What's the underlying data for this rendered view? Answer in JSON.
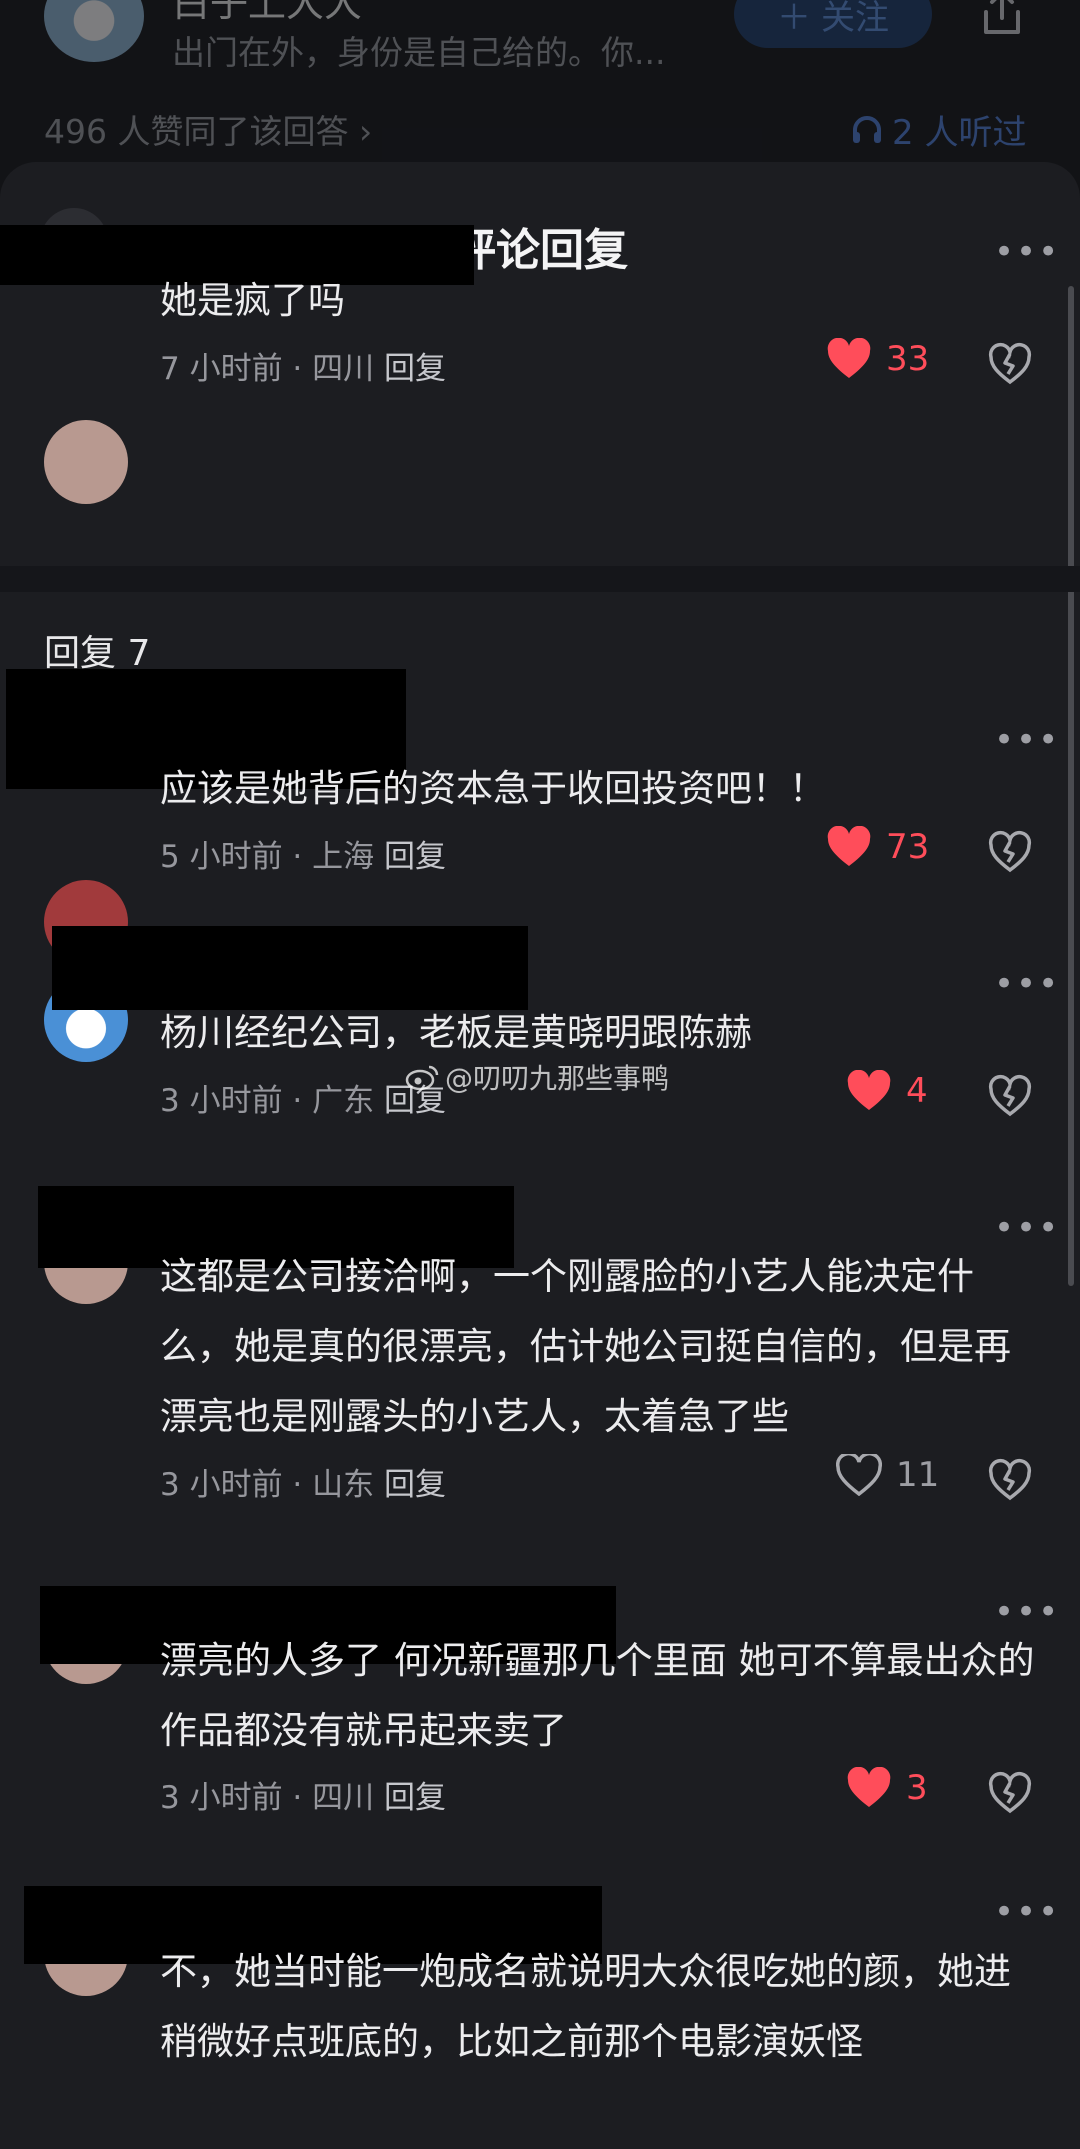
{
  "background": {
    "author_name": "白子上大大",
    "author_desc": "出门在外，身份是自己给的。你...",
    "follow_label": "关注",
    "upvote_text": "496 人赞同了该回答",
    "listen_text": "2 人听过"
  },
  "sheet": {
    "title": "评论回复",
    "reply_count_label": "回复 7"
  },
  "parent_comment": {
    "text": "她是疯了吗",
    "time": "7 小时前",
    "location": "四川",
    "reply_label": "回复",
    "likes": "33",
    "liked": true
  },
  "replies": [
    {
      "text": "应该是她背后的资本急于收回投资吧！！",
      "time": "5 小时前",
      "location": "上海",
      "reply_label": "回复",
      "likes": "73",
      "liked": true
    },
    {
      "text": "杨川经纪公司，老板是黄晓明跟陈赫",
      "time": "3 小时前",
      "location": "广东",
      "reply_label": "回复",
      "likes": "4",
      "liked": true
    },
    {
      "text": "这都是公司接洽啊，一个刚露脸的小艺人能决定什么，她是真的很漂亮，估计她公司挺自信的，但是再漂亮也是刚露头的小艺人，太着急了些",
      "time": "3 小时前",
      "location": "山东",
      "reply_label": "回复",
      "likes": "11",
      "liked": false
    },
    {
      "text": "漂亮的人多了 何况新疆那几个里面 她可不算最出众的 作品都没有就吊起来卖了",
      "time": "3 小时前",
      "location": "四川",
      "reply_label": "回复",
      "likes": "3",
      "liked": true
    },
    {
      "text": "不，她当时能一炮成名就说明大众很吃她的颜，她进稍微好点班底的，比如之前那个电影演妖怪",
      "time": "",
      "location": "",
      "reply_label": "",
      "likes": "",
      "liked": false
    }
  ],
  "watermark": "@叨叨九那些事鸭",
  "icons": {
    "back": "chevron-left-icon",
    "more": "more-dots-icon",
    "like": "heart-icon",
    "dislike": "broken-heart-icon",
    "share": "share-icon",
    "listen": "headphones-icon"
  },
  "colors": {
    "sheet_bg": "#1c1d21",
    "like_red": "#ff4d5a",
    "accent_blue": "#4f7fd9",
    "redaction": "#000000"
  }
}
